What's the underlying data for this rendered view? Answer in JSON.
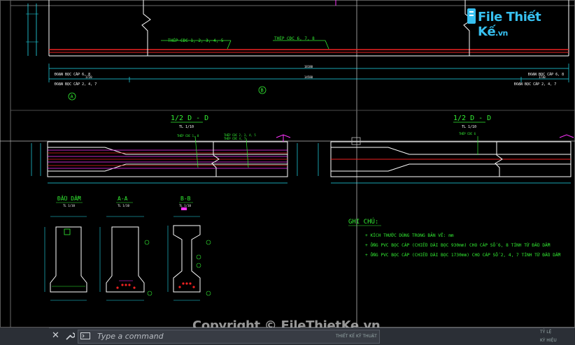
{
  "brand": {
    "name": "File Thiết Kế",
    "tld": ".vn"
  },
  "watermark": "Copyright © FileThietKe.vn",
  "command_line": {
    "placeholder": "Type a command",
    "close_glyph": "✕"
  },
  "title_block": {
    "center": "THIẾT KẾ KỸ THUẬT",
    "right1": "TỶ LỆ",
    "right2": "KÝ HIỆU"
  },
  "top_labels": {
    "steel_left": "THÉP CĐC 1, 2, 3, 4, 5",
    "steel_right": "THÉP CĐC 6, 7, 8",
    "seg_left_1": "ĐOẠN BỌC CÁP 6, 8",
    "seg_left_2": "ĐOẠN BỌC CÁP 2, 4, 7",
    "seg_right_1": "ĐOẠN BỌC CÁP 6, 8",
    "seg_right_2": "ĐOẠN BỌC CÁP 2, 4, 7",
    "dim_1720": "1720",
    "dim_14580": "14580",
    "dim_1730": "1730",
    "dim_18180": "18180",
    "marker_a": "A",
    "marker_b": "B"
  },
  "section_left": {
    "title": "1/2 D - D",
    "scale": "TL 1/10",
    "note1": "THÉP CĐC 1, 8",
    "note2": "THÉP CĐC 2, 3, 4, 5",
    "note3": "THÉP CĐC 4, 7"
  },
  "section_right": {
    "title": "1/2 D - D",
    "scale": "TL 1/10",
    "note1": "THÉP CĐC 6"
  },
  "cross_sections": [
    {
      "title": "ĐẦU DẦM",
      "scale": "TL 1/10"
    },
    {
      "title": "A-A",
      "scale": "TL 1/10"
    },
    {
      "title": "B-B",
      "scale": "TL 1/10"
    }
  ],
  "notes": {
    "heading": "GHI CHÚ:",
    "items": [
      "+ KÍCH THƯỚC DÙNG TRONG BẢN VẼ: mm",
      "+ ỐNG PVC BỌC CÁP (CHIỀU DÀI BỌC 930mm) CHO CÁP SỐ 6, 8 TÍNH TỪ ĐẦU DẦM",
      "+ ỐNG PVC BỌC CÁP (CHIỀU DÀI BỌC 1730mm) CHO CÁP SỐ 2, 4, 7 TÍNH TỪ ĐẦU DẦM"
    ]
  },
  "colors": {
    "background": "#000000",
    "line": "#ffffff",
    "green": "#33ee33",
    "red": "#ee2222",
    "magenta": "#ff33ff",
    "cyan": "#22dddd",
    "brand": "#37c0f0"
  },
  "icons": [
    "close-icon",
    "wrench-icon",
    "command-icon",
    "logo-icon"
  ]
}
